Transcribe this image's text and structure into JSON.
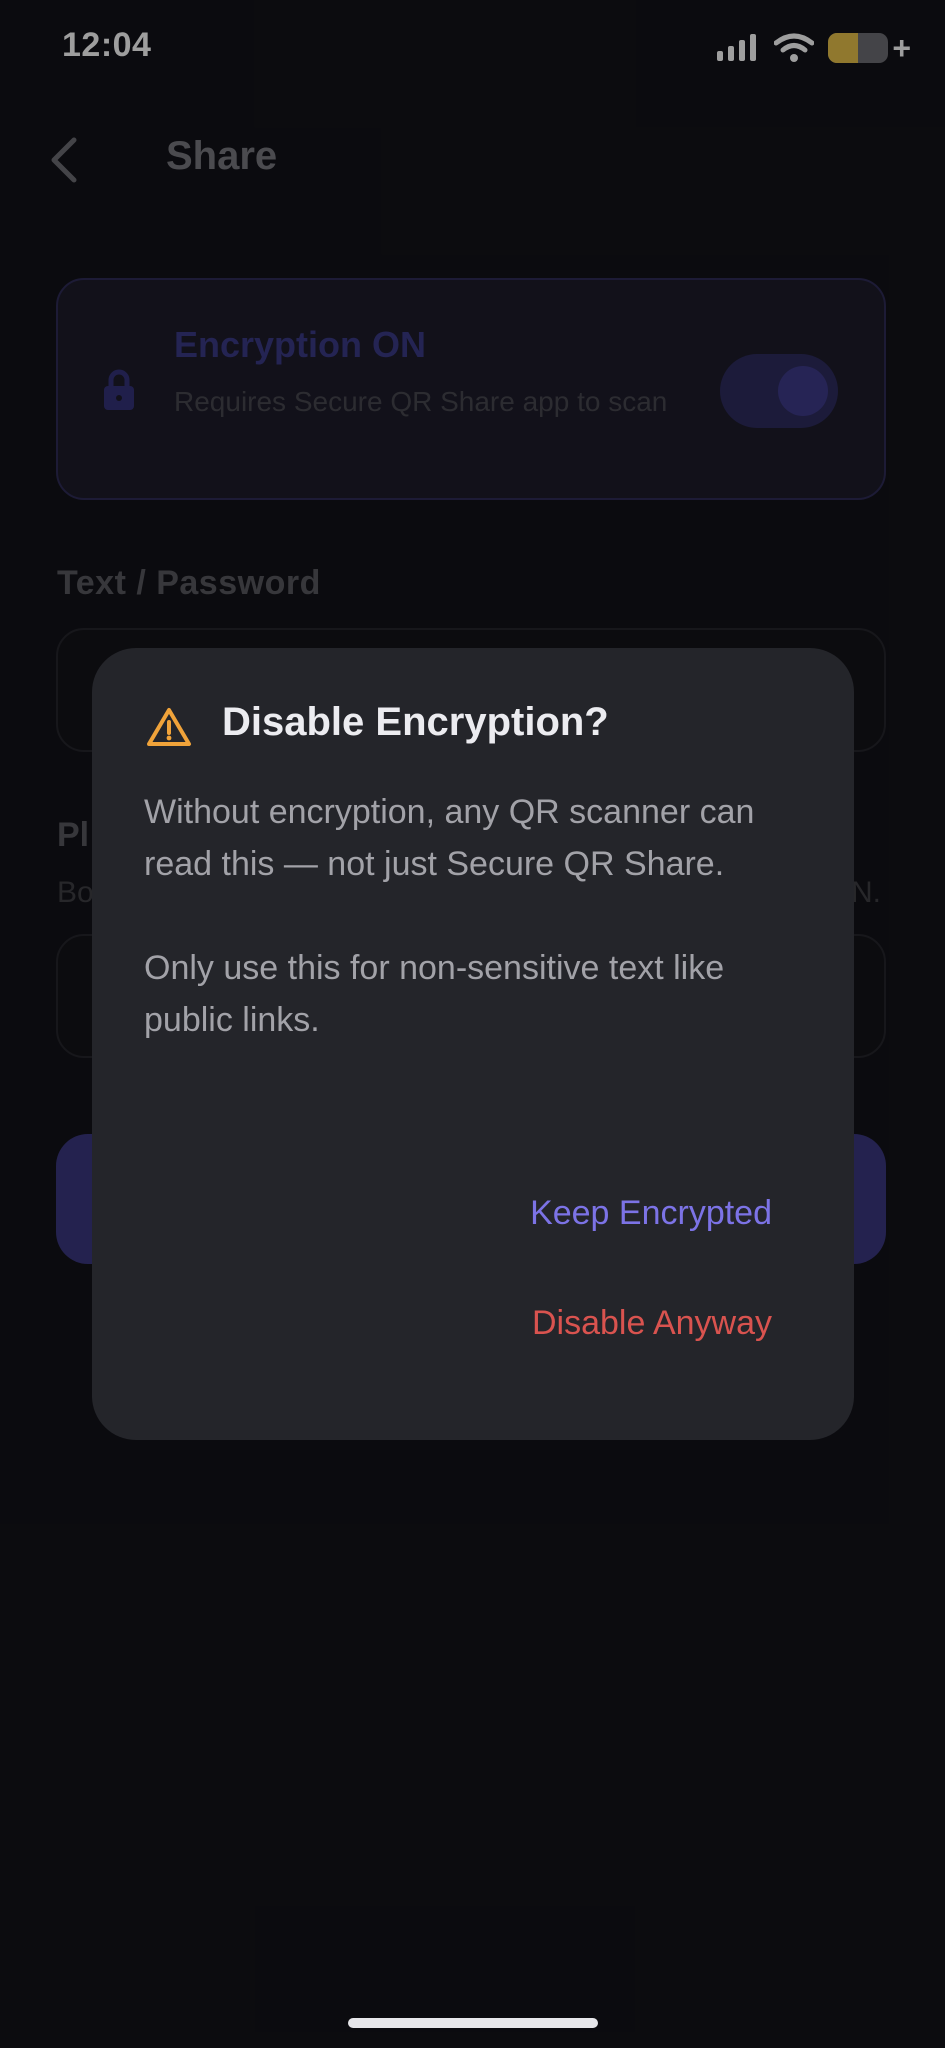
{
  "status_bar": {
    "time": "12:04",
    "icons": [
      "signal-icon",
      "wifi-icon",
      "battery-charging-icon"
    ],
    "battery_level_fraction": 0.5
  },
  "header": {
    "back_icon": "chevron-left-icon",
    "title": "Share"
  },
  "encryption_card": {
    "icon": "lock-icon",
    "title": "Encryption ON",
    "subtitle": "Requires Secure QR Share app to scan",
    "toggle_on": true
  },
  "form": {
    "text_label": "Text / Password",
    "text_value": "",
    "pin_label_partial": "Pl",
    "pin_sub_left_partial": "Bo",
    "pin_sub_right_partial": "N.",
    "pin_value": ""
  },
  "dialog": {
    "icon": "warning-icon",
    "title": "Disable Encryption?",
    "body_1": "Without encryption, any QR scanner can read this — not just Secure QR Share.",
    "body_2": "Only use this for non-sensitive text like public links.",
    "keep_label": "Keep Encrypted",
    "disable_label": "Disable Anyway"
  },
  "colors": {
    "background": "#131319",
    "dialog": "#24252a",
    "accent": "#7c73e6",
    "danger": "#d9534f",
    "warning": "#f0a33a"
  }
}
